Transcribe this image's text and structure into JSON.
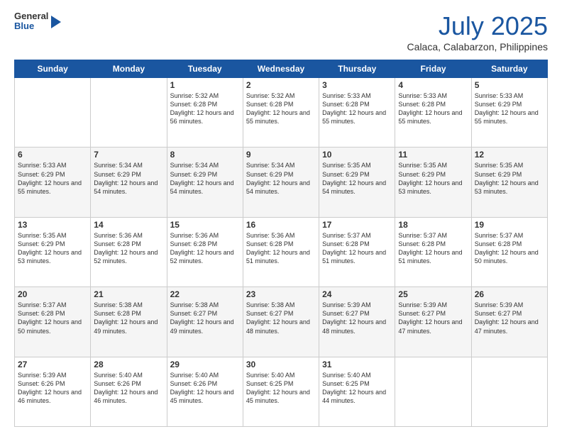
{
  "logo": {
    "general": "General",
    "blue": "Blue"
  },
  "title": {
    "month_year": "July 2025",
    "location": "Calaca, Calabarzon, Philippines"
  },
  "headers": [
    "Sunday",
    "Monday",
    "Tuesday",
    "Wednesday",
    "Thursday",
    "Friday",
    "Saturday"
  ],
  "weeks": [
    [
      {
        "day": "",
        "info": ""
      },
      {
        "day": "",
        "info": ""
      },
      {
        "day": "1",
        "info": "Sunrise: 5:32 AM\nSunset: 6:28 PM\nDaylight: 12 hours and 56 minutes."
      },
      {
        "day": "2",
        "info": "Sunrise: 5:32 AM\nSunset: 6:28 PM\nDaylight: 12 hours and 55 minutes."
      },
      {
        "day": "3",
        "info": "Sunrise: 5:33 AM\nSunset: 6:28 PM\nDaylight: 12 hours and 55 minutes."
      },
      {
        "day": "4",
        "info": "Sunrise: 5:33 AM\nSunset: 6:28 PM\nDaylight: 12 hours and 55 minutes."
      },
      {
        "day": "5",
        "info": "Sunrise: 5:33 AM\nSunset: 6:29 PM\nDaylight: 12 hours and 55 minutes."
      }
    ],
    [
      {
        "day": "6",
        "info": "Sunrise: 5:33 AM\nSunset: 6:29 PM\nDaylight: 12 hours and 55 minutes."
      },
      {
        "day": "7",
        "info": "Sunrise: 5:34 AM\nSunset: 6:29 PM\nDaylight: 12 hours and 54 minutes."
      },
      {
        "day": "8",
        "info": "Sunrise: 5:34 AM\nSunset: 6:29 PM\nDaylight: 12 hours and 54 minutes."
      },
      {
        "day": "9",
        "info": "Sunrise: 5:34 AM\nSunset: 6:29 PM\nDaylight: 12 hours and 54 minutes."
      },
      {
        "day": "10",
        "info": "Sunrise: 5:35 AM\nSunset: 6:29 PM\nDaylight: 12 hours and 54 minutes."
      },
      {
        "day": "11",
        "info": "Sunrise: 5:35 AM\nSunset: 6:29 PM\nDaylight: 12 hours and 53 minutes."
      },
      {
        "day": "12",
        "info": "Sunrise: 5:35 AM\nSunset: 6:29 PM\nDaylight: 12 hours and 53 minutes."
      }
    ],
    [
      {
        "day": "13",
        "info": "Sunrise: 5:35 AM\nSunset: 6:29 PM\nDaylight: 12 hours and 53 minutes."
      },
      {
        "day": "14",
        "info": "Sunrise: 5:36 AM\nSunset: 6:28 PM\nDaylight: 12 hours and 52 minutes."
      },
      {
        "day": "15",
        "info": "Sunrise: 5:36 AM\nSunset: 6:28 PM\nDaylight: 12 hours and 52 minutes."
      },
      {
        "day": "16",
        "info": "Sunrise: 5:36 AM\nSunset: 6:28 PM\nDaylight: 12 hours and 51 minutes."
      },
      {
        "day": "17",
        "info": "Sunrise: 5:37 AM\nSunset: 6:28 PM\nDaylight: 12 hours and 51 minutes."
      },
      {
        "day": "18",
        "info": "Sunrise: 5:37 AM\nSunset: 6:28 PM\nDaylight: 12 hours and 51 minutes."
      },
      {
        "day": "19",
        "info": "Sunrise: 5:37 AM\nSunset: 6:28 PM\nDaylight: 12 hours and 50 minutes."
      }
    ],
    [
      {
        "day": "20",
        "info": "Sunrise: 5:37 AM\nSunset: 6:28 PM\nDaylight: 12 hours and 50 minutes."
      },
      {
        "day": "21",
        "info": "Sunrise: 5:38 AM\nSunset: 6:28 PM\nDaylight: 12 hours and 49 minutes."
      },
      {
        "day": "22",
        "info": "Sunrise: 5:38 AM\nSunset: 6:27 PM\nDaylight: 12 hours and 49 minutes."
      },
      {
        "day": "23",
        "info": "Sunrise: 5:38 AM\nSunset: 6:27 PM\nDaylight: 12 hours and 48 minutes."
      },
      {
        "day": "24",
        "info": "Sunrise: 5:39 AM\nSunset: 6:27 PM\nDaylight: 12 hours and 48 minutes."
      },
      {
        "day": "25",
        "info": "Sunrise: 5:39 AM\nSunset: 6:27 PM\nDaylight: 12 hours and 47 minutes."
      },
      {
        "day": "26",
        "info": "Sunrise: 5:39 AM\nSunset: 6:27 PM\nDaylight: 12 hours and 47 minutes."
      }
    ],
    [
      {
        "day": "27",
        "info": "Sunrise: 5:39 AM\nSunset: 6:26 PM\nDaylight: 12 hours and 46 minutes."
      },
      {
        "day": "28",
        "info": "Sunrise: 5:40 AM\nSunset: 6:26 PM\nDaylight: 12 hours and 46 minutes."
      },
      {
        "day": "29",
        "info": "Sunrise: 5:40 AM\nSunset: 6:26 PM\nDaylight: 12 hours and 45 minutes."
      },
      {
        "day": "30",
        "info": "Sunrise: 5:40 AM\nSunset: 6:25 PM\nDaylight: 12 hours and 45 minutes."
      },
      {
        "day": "31",
        "info": "Sunrise: 5:40 AM\nSunset: 6:25 PM\nDaylight: 12 hours and 44 minutes."
      },
      {
        "day": "",
        "info": ""
      },
      {
        "day": "",
        "info": ""
      }
    ]
  ]
}
